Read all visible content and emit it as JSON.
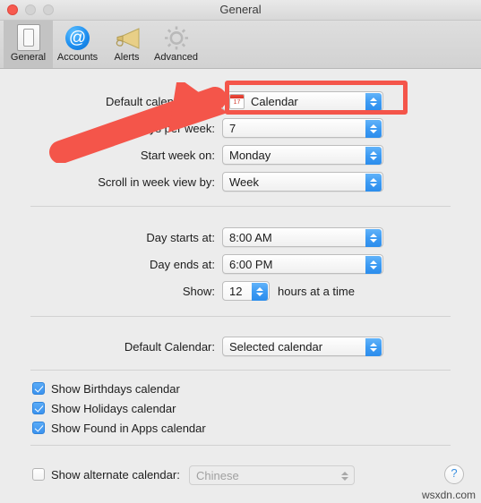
{
  "window": {
    "title": "General",
    "controls": {
      "close": "close",
      "minimize": "minimize",
      "maximize": "maximize"
    }
  },
  "toolbar": {
    "items": [
      {
        "label": "General",
        "icon": "general-icon",
        "selected": true
      },
      {
        "label": "Accounts",
        "icon": "at-sign-icon",
        "selected": false
      },
      {
        "label": "Alerts",
        "icon": "megaphone-icon",
        "selected": false
      },
      {
        "label": "Advanced",
        "icon": "gear-icon",
        "selected": false
      }
    ]
  },
  "form": {
    "default_calendar_app": {
      "label": "Default calendar app:",
      "value": "Calendar",
      "icon": "calendar-app-icon",
      "icon_day": "17"
    },
    "days_per_week": {
      "label": "Days per week:",
      "value": "7"
    },
    "start_week_on": {
      "label": "Start week on:",
      "value": "Monday"
    },
    "scroll_week_view": {
      "label": "Scroll in week view by:",
      "value": "Week"
    },
    "day_starts_at": {
      "label": "Day starts at:",
      "value": "8:00 AM"
    },
    "day_ends_at": {
      "label": "Day ends at:",
      "value": "6:00 PM"
    },
    "show_hours": {
      "label": "Show:",
      "value": "12",
      "suffix": "hours at a time"
    },
    "default_calendar": {
      "label": "Default Calendar:",
      "value": "Selected calendar"
    }
  },
  "checkboxes": [
    {
      "label": "Show Birthdays calendar",
      "checked": true
    },
    {
      "label": "Show Holidays calendar",
      "checked": true
    },
    {
      "label": "Show Found in Apps calendar",
      "checked": true
    }
  ],
  "alternate_calendar": {
    "label": "Show alternate calendar:",
    "checked": false,
    "value": "Chinese",
    "disabled": true
  },
  "help_button": {
    "label": "?"
  },
  "watermark": {
    "text": "wsxdn.com"
  },
  "colors": {
    "accent_blue": "#3d9bf3",
    "annotation_red": "#f4554a",
    "window_bg": "#ececec",
    "text": "#1d1d1d"
  }
}
